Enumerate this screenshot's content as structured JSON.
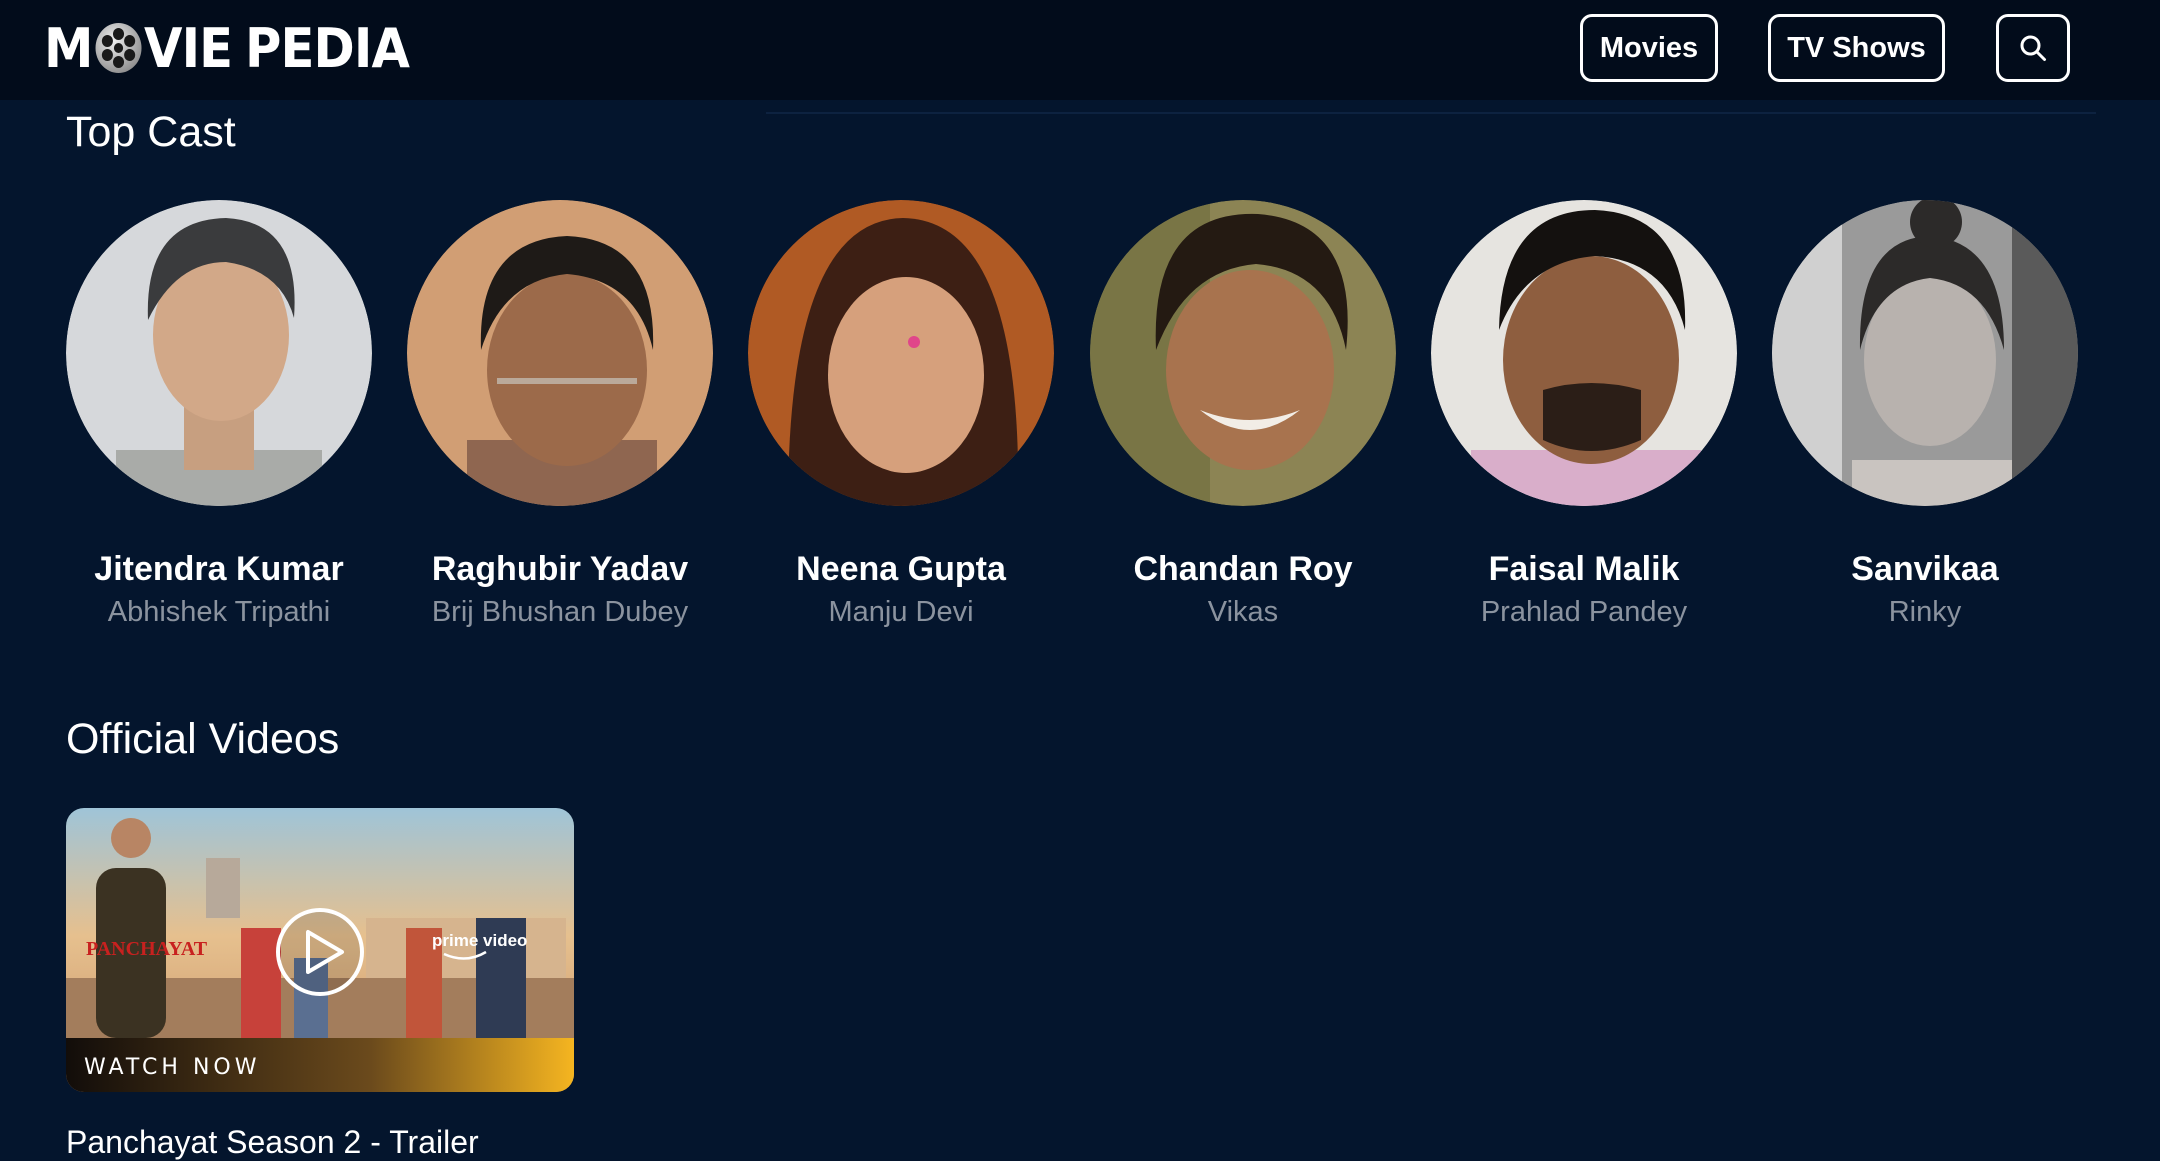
{
  "header": {
    "logo_left": "M",
    "logo_right": "VIE",
    "logo_word2": "PEDIA",
    "nav": {
      "movies_label": "Movies",
      "tv_label": "TV Shows"
    }
  },
  "top_cast": {
    "title": "Top Cast",
    "members": [
      {
        "name": "Jitendra Kumar",
        "character": "Abhishek Tripathi"
      },
      {
        "name": "Raghubir Yadav",
        "character": "Brij Bhushan Dubey"
      },
      {
        "name": "Neena Gupta",
        "character": "Manju Devi"
      },
      {
        "name": "Chandan Roy",
        "character": "Vikas"
      },
      {
        "name": "Faisal Malik",
        "character": "Prahlad Pandey"
      },
      {
        "name": "Sanvikaa",
        "character": "Rinky"
      }
    ]
  },
  "official_videos": {
    "title": "Official Videos",
    "videos": [
      {
        "thumbnail_text": "PANCHAYAT",
        "thumbnail_brand": "prime video",
        "watch_label": "WATCH NOW",
        "title": "Panchayat Season 2 - Trailer"
      }
    ]
  },
  "colors": {
    "background": "#04152d",
    "header_bg": "#020c1b",
    "muted_text": "#8b939f",
    "accent_gold": "#f5b520"
  },
  "icons": [
    "film-reel-icon",
    "search-icon",
    "play-icon"
  ]
}
